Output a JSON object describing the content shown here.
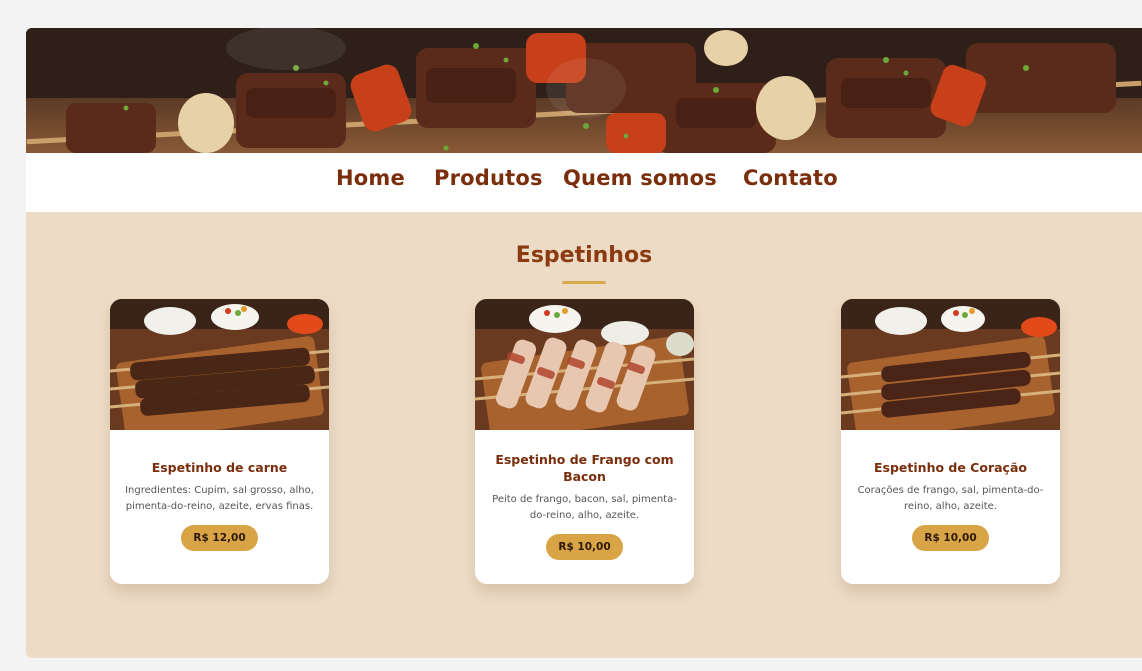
{
  "nav": {
    "items": [
      {
        "label": "Home"
      },
      {
        "label": "Produtos"
      },
      {
        "label": "Quem somos"
      },
      {
        "label": "Contato"
      }
    ]
  },
  "section": {
    "title": "Espetinhos"
  },
  "products": [
    {
      "title": "Espetinho de carne",
      "description": "Ingredientes: Cupim, sal grosso, alho, pimenta-do-reino, azeite, ervas finas.",
      "price": "R$ 12,00"
    },
    {
      "title": "Espetinho de Frango com Bacon",
      "description": "Peito de frango, bacon, sal, pimenta-do-reino, alho, azeite.",
      "price": "R$ 10,00"
    },
    {
      "title": "Espetinho de Coração",
      "description": "Corações de frango, sal, pimenta-do-reino, alho, azeite.",
      "price": "R$ 10,00"
    }
  ],
  "colors": {
    "brand": "#7a2e0c",
    "section_bg": "#ecdcc6",
    "price_badge": "#d9a445",
    "accent_line": "#d9a84a"
  }
}
